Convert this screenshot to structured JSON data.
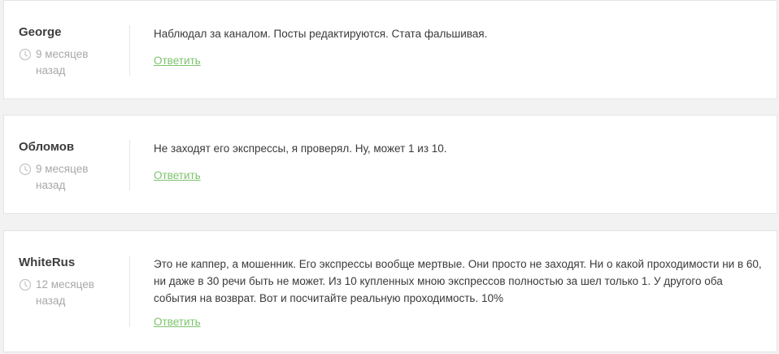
{
  "comments": [
    {
      "author": "George",
      "time": "9 месяцев назад",
      "text": "Наблюдал за каналом. Посты редактируются. Стата фальшивая.",
      "reply_label": "Ответить"
    },
    {
      "author": "Обломов",
      "time": "9 месяцев назад",
      "text": "Не заходят его экспрессы, я проверял. Ну, может 1 из 10.",
      "reply_label": "Ответить"
    },
    {
      "author": "WhiteRus",
      "time": "12 месяцев назад",
      "text": "Это не каппер, а мошенник. Его экспрессы вообще мертвые. Они просто не заходят. Ни о какой проходимости ни в 60, ни даже в 30 речи быть не может. Из 10 купленных мною экспрессов полностью за шел только 1. У другого оба события на возврат. Вот и посчитайте реальную проходимость. 10%",
      "reply_label": "Ответить"
    }
  ],
  "icons": {
    "time": "clock-icon"
  },
  "colors": {
    "background": "#f2f2f2",
    "card": "#ffffff",
    "author": "#3d3d3d",
    "meta": "#a8a8a8",
    "text": "#3a3a3a",
    "link": "#7cc36b"
  }
}
